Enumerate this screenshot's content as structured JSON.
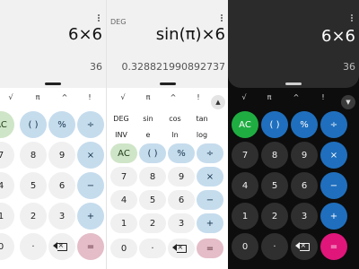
{
  "left_panel": {
    "expression": "6×6",
    "result": "36",
    "sci_row": [
      "√",
      "π",
      "^",
      "!"
    ],
    "keys": [
      [
        "AC",
        "( )",
        "%",
        "÷"
      ],
      [
        "7",
        "8",
        "9",
        "×"
      ],
      [
        "4",
        "5",
        "6",
        "−"
      ],
      [
        "1",
        "2",
        "3",
        "+"
      ],
      [
        "0",
        "·",
        "⌫",
        "="
      ]
    ]
  },
  "middle_panel": {
    "angle_mode": "DEG",
    "expression": "sin(π)×6",
    "result": "0.328821990892737",
    "sci_row": [
      "√",
      "π",
      "^",
      "!"
    ],
    "sci_row2": [
      "DEG",
      "sin",
      "cos",
      "tan"
    ],
    "sci_row3": [
      "INV",
      "e",
      "ln",
      "log"
    ],
    "keys": [
      [
        "AC",
        "( )",
        "%",
        "÷"
      ],
      [
        "7",
        "8",
        "9",
        "×"
      ],
      [
        "4",
        "5",
        "6",
        "−"
      ],
      [
        "1",
        "2",
        "3",
        "+"
      ],
      [
        "0",
        "·",
        "⌫",
        "="
      ]
    ]
  },
  "right_panel": {
    "expression": "6×6",
    "result": "36",
    "sci_row": [
      "√",
      "π",
      "^",
      "!"
    ],
    "keys": [
      [
        "AC",
        "( )",
        "%",
        "÷"
      ],
      [
        "7",
        "8",
        "9",
        "×"
      ],
      [
        "4",
        "5",
        "6",
        "−"
      ],
      [
        "1",
        "2",
        "3",
        "+"
      ],
      [
        "0",
        "·",
        "⌫",
        "="
      ]
    ]
  },
  "icons": {
    "menu": "overflow-menu-icon",
    "expand": "chevron-down-icon",
    "backspace": "backspace-icon"
  },
  "colors": {
    "light_operator": "#c5dced",
    "light_ac": "#cfe5c7",
    "light_equals": "#e4bdc8",
    "dark_operator": "#1f6fbe",
    "dark_ac": "#1fad42",
    "dark_equals": "#e0167b"
  }
}
